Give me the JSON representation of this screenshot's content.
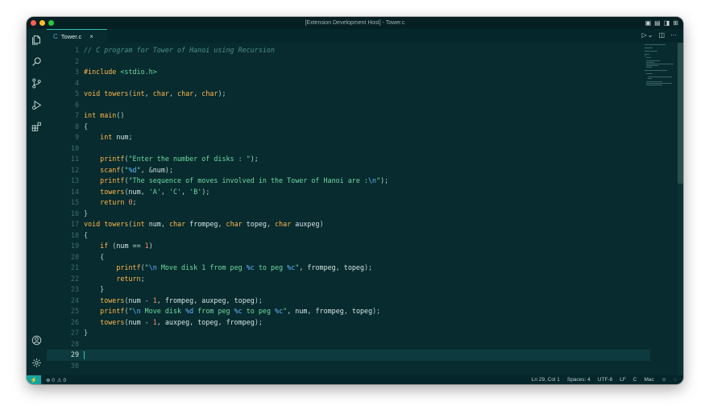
{
  "window": {
    "title": "[Extension Development Host] - Tower.c"
  },
  "tab": {
    "lang_icon": "C",
    "filename": "Tower.c",
    "close_glyph": "×"
  },
  "tab_actions": {
    "run_glyph": "▷",
    "run_menu_glyph": "⌄",
    "split_glyph": "◫",
    "more_glyph": "···"
  },
  "activity_icons": [
    "explorer-icon",
    "search-icon",
    "source-control-icon",
    "run-debug-icon",
    "extensions-icon",
    "account-icon",
    "settings-gear-icon"
  ],
  "editor": {
    "current_line": 29,
    "lines": [
      {
        "n": "1",
        "tokens": [
          [
            "com",
            "// C program for Tower of Hanoi using Recursion"
          ]
        ]
      },
      {
        "n": "2",
        "tokens": []
      },
      {
        "n": "3",
        "tokens": [
          [
            "kw",
            "#include "
          ],
          [
            "inc",
            "<stdio.h>"
          ]
        ]
      },
      {
        "n": "4",
        "tokens": []
      },
      {
        "n": "5",
        "tokens": [
          [
            "type",
            "void "
          ],
          [
            "fn",
            "towers"
          ],
          [
            "pun",
            "("
          ],
          [
            "type",
            "int"
          ],
          [
            "pun",
            ", "
          ],
          [
            "type",
            "char"
          ],
          [
            "pun",
            ", "
          ],
          [
            "type",
            "char"
          ],
          [
            "pun",
            ", "
          ],
          [
            "type",
            "char"
          ],
          [
            "pun",
            ");"
          ]
        ]
      },
      {
        "n": "6",
        "tokens": []
      },
      {
        "n": "7",
        "tokens": [
          [
            "type",
            "int "
          ],
          [
            "fn",
            "main"
          ],
          [
            "pun",
            "()"
          ]
        ]
      },
      {
        "n": "8",
        "tokens": [
          [
            "pun",
            "{"
          ]
        ]
      },
      {
        "n": "9",
        "tokens": [
          [
            "var",
            "    "
          ],
          [
            "type",
            "int "
          ],
          [
            "var",
            "num"
          ],
          [
            "pun",
            ";"
          ]
        ]
      },
      {
        "n": "10",
        "tokens": []
      },
      {
        "n": "11",
        "tokens": [
          [
            "var",
            "    "
          ],
          [
            "fn",
            "printf"
          ],
          [
            "pun",
            "("
          ],
          [
            "str",
            "\"Enter the number of disks : \""
          ],
          [
            "pun",
            ");"
          ]
        ]
      },
      {
        "n": "12",
        "tokens": [
          [
            "var",
            "    "
          ],
          [
            "fn",
            "scanf"
          ],
          [
            "pun",
            "("
          ],
          [
            "str",
            "\""
          ],
          [
            "fmt",
            "%d"
          ],
          [
            "str",
            "\""
          ],
          [
            "pun",
            ", &"
          ],
          [
            "var",
            "num"
          ],
          [
            "pun",
            ");"
          ]
        ]
      },
      {
        "n": "13",
        "tokens": [
          [
            "var",
            "    "
          ],
          [
            "fn",
            "printf"
          ],
          [
            "pun",
            "("
          ],
          [
            "str",
            "\"The sequence of moves involved in the Tower of Hanoi are :"
          ],
          [
            "fmt",
            "\\n"
          ],
          [
            "str",
            "\""
          ],
          [
            "pun",
            ");"
          ]
        ]
      },
      {
        "n": "14",
        "tokens": [
          [
            "var",
            "    "
          ],
          [
            "fn",
            "towers"
          ],
          [
            "pun",
            "("
          ],
          [
            "var",
            "num"
          ],
          [
            "pun",
            ", "
          ],
          [
            "str",
            "'A'"
          ],
          [
            "pun",
            ", "
          ],
          [
            "str",
            "'C'"
          ],
          [
            "pun",
            ", "
          ],
          [
            "str",
            "'B'"
          ],
          [
            "pun",
            ");"
          ]
        ]
      },
      {
        "n": "15",
        "tokens": [
          [
            "var",
            "    "
          ],
          [
            "kw",
            "return "
          ],
          [
            "num",
            "0"
          ],
          [
            "pun",
            ";"
          ]
        ]
      },
      {
        "n": "16",
        "tokens": [
          [
            "pun",
            "}"
          ]
        ]
      },
      {
        "n": "17",
        "tokens": [
          [
            "type",
            "void "
          ],
          [
            "fn",
            "towers"
          ],
          [
            "pun",
            "("
          ],
          [
            "type",
            "int "
          ],
          [
            "var",
            "num"
          ],
          [
            "pun",
            ", "
          ],
          [
            "type",
            "char "
          ],
          [
            "var",
            "frompeg"
          ],
          [
            "pun",
            ", "
          ],
          [
            "type",
            "char "
          ],
          [
            "var",
            "topeg"
          ],
          [
            "pun",
            ", "
          ],
          [
            "type",
            "char "
          ],
          [
            "var",
            "auxpeg"
          ],
          [
            "pun",
            ")"
          ]
        ]
      },
      {
        "n": "18",
        "tokens": [
          [
            "pun",
            "{"
          ]
        ]
      },
      {
        "n": "19",
        "tokens": [
          [
            "var",
            "    "
          ],
          [
            "kw",
            "if "
          ],
          [
            "pun",
            "("
          ],
          [
            "var",
            "num "
          ],
          [
            "pun",
            "== "
          ],
          [
            "num",
            "1"
          ],
          [
            "pun",
            ")"
          ]
        ]
      },
      {
        "n": "20",
        "tokens": [
          [
            "var",
            "    "
          ],
          [
            "pun",
            "{"
          ]
        ]
      },
      {
        "n": "21",
        "tokens": [
          [
            "var",
            "        "
          ],
          [
            "fn",
            "printf"
          ],
          [
            "pun",
            "("
          ],
          [
            "str",
            "\""
          ],
          [
            "fmt",
            "\\n"
          ],
          [
            "str",
            " Move disk 1 from peg "
          ],
          [
            "fmt",
            "%c"
          ],
          [
            "str",
            " to peg "
          ],
          [
            "fmt",
            "%c"
          ],
          [
            "str",
            "\""
          ],
          [
            "pun",
            ", "
          ],
          [
            "var",
            "frompeg"
          ],
          [
            "pun",
            ", "
          ],
          [
            "var",
            "topeg"
          ],
          [
            "pun",
            ");"
          ]
        ]
      },
      {
        "n": "22",
        "tokens": [
          [
            "var",
            "        "
          ],
          [
            "kw",
            "return"
          ],
          [
            "pun",
            ";"
          ]
        ]
      },
      {
        "n": "23",
        "tokens": [
          [
            "var",
            "    "
          ],
          [
            "pun",
            "}"
          ]
        ]
      },
      {
        "n": "24",
        "tokens": [
          [
            "var",
            "    "
          ],
          [
            "fn",
            "towers"
          ],
          [
            "pun",
            "("
          ],
          [
            "var",
            "num "
          ],
          [
            "pun",
            "- "
          ],
          [
            "num",
            "1"
          ],
          [
            "pun",
            ", "
          ],
          [
            "var",
            "frompeg"
          ],
          [
            "pun",
            ", "
          ],
          [
            "var",
            "auxpeg"
          ],
          [
            "pun",
            ", "
          ],
          [
            "var",
            "topeg"
          ],
          [
            "pun",
            ");"
          ]
        ]
      },
      {
        "n": "25",
        "tokens": [
          [
            "var",
            "    "
          ],
          [
            "fn",
            "printf"
          ],
          [
            "pun",
            "("
          ],
          [
            "str",
            "\""
          ],
          [
            "fmt",
            "\\n"
          ],
          [
            "str",
            " Move disk "
          ],
          [
            "fmt",
            "%d"
          ],
          [
            "str",
            " from peg "
          ],
          [
            "fmt",
            "%c"
          ],
          [
            "str",
            " to peg "
          ],
          [
            "fmt",
            "%c"
          ],
          [
            "str",
            "\""
          ],
          [
            "pun",
            ", "
          ],
          [
            "var",
            "num"
          ],
          [
            "pun",
            ", "
          ],
          [
            "var",
            "frompeg"
          ],
          [
            "pun",
            ", "
          ],
          [
            "var",
            "topeg"
          ],
          [
            "pun",
            ");"
          ]
        ]
      },
      {
        "n": "26",
        "tokens": [
          [
            "var",
            "    "
          ],
          [
            "fn",
            "towers"
          ],
          [
            "pun",
            "("
          ],
          [
            "var",
            "num "
          ],
          [
            "pun",
            "- "
          ],
          [
            "num",
            "1"
          ],
          [
            "pun",
            ", "
          ],
          [
            "var",
            "auxpeg"
          ],
          [
            "pun",
            ", "
          ],
          [
            "var",
            "topeg"
          ],
          [
            "pun",
            ", "
          ],
          [
            "var",
            "frompeg"
          ],
          [
            "pun",
            ");"
          ]
        ]
      },
      {
        "n": "27",
        "tokens": [
          [
            "pun",
            "}"
          ]
        ]
      },
      {
        "n": "28",
        "tokens": []
      },
      {
        "n": "29",
        "tokens": []
      },
      {
        "n": "30",
        "tokens": []
      }
    ]
  },
  "statusbar": {
    "remote_glyph": "⚡",
    "errors": "⊗ 0",
    "warnings": "⚠ 0",
    "position": "Ln 29, Col 1",
    "spaces": "Spaces: 4",
    "encoding": "UTF-8",
    "eol": "LF",
    "language": "C",
    "platform": "Mac",
    "feedback_glyph": "☺",
    "bell_glyph": "🔔"
  },
  "colors": {
    "background": "#072b2e",
    "accent": "#2ec4b6",
    "keyword": "#ffb84d",
    "string": "#6fd9a3",
    "format": "#5eb8ff",
    "number": "#f58f64"
  }
}
